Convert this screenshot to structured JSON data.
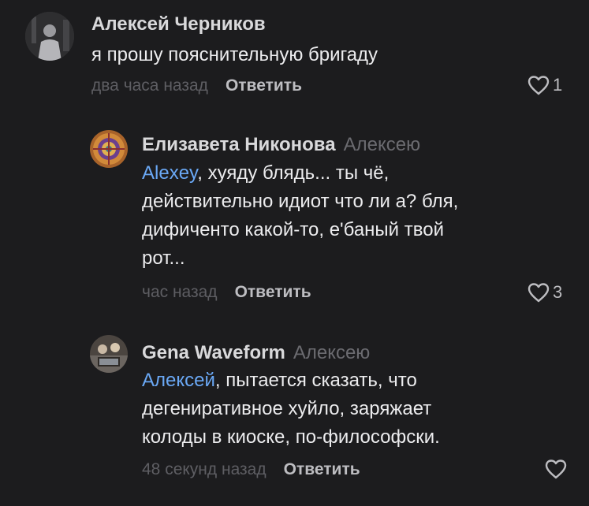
{
  "comments": [
    {
      "author": "Алексей Черников",
      "reply_to": "",
      "mention": "",
      "text": [
        "я прошу пояснительную бригаду"
      ],
      "time": "два часа назад",
      "reply_label": "Ответить",
      "likes": "1"
    },
    {
      "author": "Елизавета Никонова",
      "reply_to": "Алексею",
      "mention": "Alexey",
      "text": [
        ", хуяду блядь... ты чё,",
        "действительно идиот что ли а? бля,",
        "дифиченто какой-то, е'баный твой",
        "рот..."
      ],
      "time": "час назад",
      "reply_label": "Ответить",
      "likes": "3"
    },
    {
      "author": "Gena Waveform",
      "reply_to": "Алексею",
      "mention": "Алексей",
      "text": [
        ", пытается сказать, что",
        "дегениративное хуйло, заряжает",
        "колоды в киоске, по-философски."
      ],
      "time": "48 секунд назад",
      "reply_label": "Ответить",
      "likes": ""
    }
  ],
  "colors": {
    "background": "#1c1c1e",
    "mention": "#6aa8f5",
    "muted": "#5e5e63"
  }
}
